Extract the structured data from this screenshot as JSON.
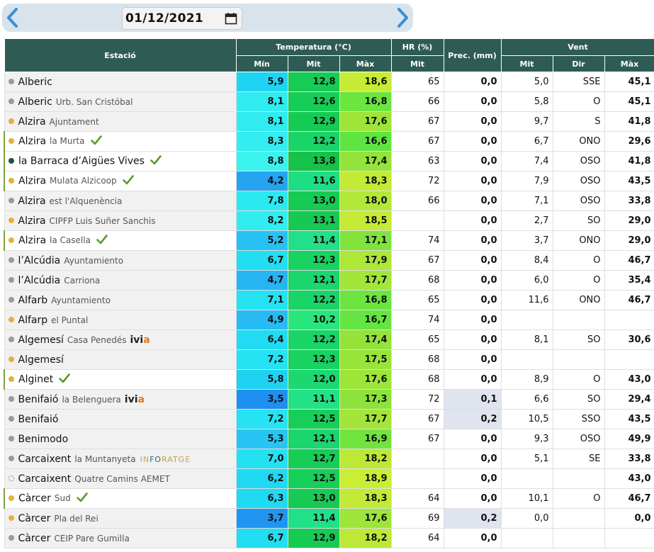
{
  "date_picker": {
    "value": "01/12/2021",
    "prev_icon": "chevron-left-icon",
    "next_icon": "chevron-right-icon",
    "calendar_icon": "calendar-icon",
    "accent": "#3a8fd6"
  },
  "table": {
    "headers": {
      "station": "Estació",
      "temperature": "Temperatura (°C)",
      "humidity": "HR (%)",
      "precipitation": "Prec. (mm)",
      "wind": "Vent"
    },
    "subheaders": {
      "temp_min": "Mín",
      "temp_mean": "Mit",
      "temp_max": "Màx",
      "hr_mean": "Mit",
      "wind_mean": "Mit",
      "wind_dir": "Dir",
      "wind_max": "Màx"
    },
    "header_color": "#2e5c54",
    "rows": [
      {
        "city": "Alberic",
        "sub": "",
        "dot": "#9a9a9a",
        "check": false,
        "sel": false,
        "brand": "",
        "tmin": "5,9",
        "tmit": "12,8",
        "tmax": "18,6",
        "hr": "65",
        "prec": "0,0",
        "vmit": "5,0",
        "vdir": "SSE",
        "vmax": "45,1"
      },
      {
        "city": "Alberic",
        "sub": "Urb. San Cristóbal",
        "dot": "#9a9a9a",
        "check": false,
        "sel": false,
        "brand": "",
        "tmin": "8,1",
        "tmit": "12,6",
        "tmax": "16,8",
        "hr": "66",
        "prec": "0,0",
        "vmit": "5,8",
        "vdir": "O",
        "vmax": "45,1"
      },
      {
        "city": "Alzira",
        "sub": "Ajuntament",
        "dot": "#e3b23c",
        "check": false,
        "sel": false,
        "brand": "",
        "tmin": "8,1",
        "tmit": "12,9",
        "tmax": "17,6",
        "hr": "67",
        "prec": "0,0",
        "vmit": "9,7",
        "vdir": "S",
        "vmax": "41,8"
      },
      {
        "city": "Alzira",
        "sub": "la Murta",
        "dot": "#e3b23c",
        "check": true,
        "sel": true,
        "brand": "",
        "tmin": "8,3",
        "tmit": "12,2",
        "tmax": "16,6",
        "hr": "67",
        "prec": "0,0",
        "vmit": "6,7",
        "vdir": "ONO",
        "vmax": "29,6"
      },
      {
        "city": "la Barraca d’Aigües Vives",
        "sub": "",
        "dot": "#1f4f4a",
        "check": true,
        "sel": true,
        "brand": "",
        "tmin": "8,8",
        "tmit": "13,8",
        "tmax": "17,4",
        "hr": "63",
        "prec": "0,0",
        "vmit": "7,4",
        "vdir": "OSO",
        "vmax": "41,8"
      },
      {
        "city": "Alzira",
        "sub": "Mulata Alzicoop",
        "dot": "#e3b23c",
        "check": true,
        "sel": true,
        "brand": "",
        "tmin": "4,2",
        "tmit": "11,6",
        "tmax": "18,3",
        "hr": "72",
        "prec": "0,0",
        "vmit": "7,9",
        "vdir": "OSO",
        "vmax": "43,5"
      },
      {
        "city": "Alzira",
        "sub": "est l'Alquenència",
        "dot": "#9a9a9a",
        "check": false,
        "sel": false,
        "brand": "",
        "tmin": "7,8",
        "tmit": "13,0",
        "tmax": "18,0",
        "hr": "66",
        "prec": "0,0",
        "vmit": "7,1",
        "vdir": "OSO",
        "vmax": "33,8"
      },
      {
        "city": "Alzira",
        "sub": "CIPFP Luis Suñer Sanchis",
        "dot": "#e3b23c",
        "check": false,
        "sel": false,
        "brand": "",
        "tmin": "8,2",
        "tmit": "13,1",
        "tmax": "18,5",
        "hr": "",
        "prec": "0,0",
        "vmit": "2,7",
        "vdir": "SO",
        "vmax": "29,0"
      },
      {
        "city": "Alzira",
        "sub": "la Casella",
        "dot": "#e3b23c",
        "check": true,
        "sel": true,
        "brand": "",
        "tmin": "5,2",
        "tmit": "11,4",
        "tmax": "17,1",
        "hr": "74",
        "prec": "0,0",
        "vmit": "3,7",
        "vdir": "ONO",
        "vmax": "29,0"
      },
      {
        "city": "l’Alcúdia",
        "sub": "Ayuntamiento",
        "dot": "#9a9a9a",
        "check": false,
        "sel": false,
        "brand": "",
        "tmin": "6,7",
        "tmit": "12,3",
        "tmax": "17,9",
        "hr": "67",
        "prec": "0,0",
        "vmit": "8,4",
        "vdir": "O",
        "vmax": "46,7"
      },
      {
        "city": "l’Alcúdia",
        "sub": "Carriona",
        "dot": "#9a9a9a",
        "check": false,
        "sel": false,
        "brand": "",
        "tmin": "4,7",
        "tmit": "12,1",
        "tmax": "17,7",
        "hr": "68",
        "prec": "0,0",
        "vmit": "6,0",
        "vdir": "O",
        "vmax": "35,4"
      },
      {
        "city": "Alfarb",
        "sub": "Ayuntamiento",
        "dot": "#9a9a9a",
        "check": false,
        "sel": false,
        "brand": "",
        "tmin": "7,1",
        "tmit": "12,2",
        "tmax": "16,8",
        "hr": "65",
        "prec": "0,0",
        "vmit": "11,6",
        "vdir": "ONO",
        "vmax": "46,7"
      },
      {
        "city": "Alfarp",
        "sub": "el Puntal",
        "dot": "#e3b23c",
        "check": false,
        "sel": false,
        "brand": "",
        "tmin": "4,9",
        "tmit": "10,2",
        "tmax": "16,7",
        "hr": "74",
        "prec": "0,0",
        "vmit": "",
        "vdir": "",
        "vmax": ""
      },
      {
        "city": "Algemesí",
        "sub": "Casa Penedés",
        "dot": "#9a9a9a",
        "check": false,
        "sel": false,
        "brand": "ivia",
        "tmin": "6,4",
        "tmit": "12,2",
        "tmax": "17,4",
        "hr": "65",
        "prec": "0,0",
        "vmit": "8,1",
        "vdir": "SO",
        "vmax": "30,6"
      },
      {
        "city": "Algemesí",
        "sub": "",
        "dot": "#e3b23c",
        "check": false,
        "sel": false,
        "brand": "",
        "tmin": "7,2",
        "tmit": "12,3",
        "tmax": "17,5",
        "hr": "68",
        "prec": "0,0",
        "vmit": "",
        "vdir": "",
        "vmax": ""
      },
      {
        "city": "Alginet",
        "sub": "",
        "dot": "#e3b23c",
        "check": true,
        "sel": true,
        "brand": "",
        "tmin": "5,8",
        "tmit": "12,0",
        "tmax": "17,6",
        "hr": "68",
        "prec": "0,0",
        "vmit": "8,9",
        "vdir": "O",
        "vmax": "43,0"
      },
      {
        "city": "Benifaió",
        "sub": "la Belenguera",
        "dot": "#9a9a9a",
        "check": false,
        "sel": false,
        "brand": "ivia",
        "tmin": "3,5",
        "tmit": "11,1",
        "tmax": "17,3",
        "hr": "72",
        "prec": "0,1",
        "vmit": "6,6",
        "vdir": "SO",
        "vmax": "29,4"
      },
      {
        "city": "Benifaió",
        "sub": "",
        "dot": "#9a9a9a",
        "check": false,
        "sel": false,
        "brand": "",
        "tmin": "7,2",
        "tmit": "12,5",
        "tmax": "17,7",
        "hr": "67",
        "prec": "0,2",
        "vmit": "10,5",
        "vdir": "SSO",
        "vmax": "43,5"
      },
      {
        "city": "Benimodo",
        "sub": "",
        "dot": "#9a9a9a",
        "check": false,
        "sel": false,
        "brand": "",
        "tmin": "5,3",
        "tmit": "12,1",
        "tmax": "16,9",
        "hr": "67",
        "prec": "0,0",
        "vmit": "9,3",
        "vdir": "OSO",
        "vmax": "49,9"
      },
      {
        "city": "Carcaixent",
        "sub": "la Muntanyeta",
        "dot": "#9a9a9a",
        "check": false,
        "sel": false,
        "brand": "inforatge",
        "tmin": "7,0",
        "tmit": "12,7",
        "tmax": "18,2",
        "hr": "",
        "prec": "0,0",
        "vmit": "5,1",
        "vdir": "SE",
        "vmax": "33,8"
      },
      {
        "city": "Carcaixent",
        "sub": "Quatre Camins AEMET",
        "dot": "hollow",
        "check": false,
        "sel": false,
        "brand": "",
        "tmin": "6,2",
        "tmit": "12,5",
        "tmax": "18,9",
        "hr": "",
        "prec": "0,0",
        "vmit": "",
        "vdir": "",
        "vmax": "43,0"
      },
      {
        "city": "Càrcer",
        "sub": "Sud",
        "dot": "#e3b23c",
        "check": true,
        "sel": true,
        "brand": "",
        "tmin": "6,3",
        "tmit": "13,0",
        "tmax": "18,3",
        "hr": "64",
        "prec": "0,0",
        "vmit": "10,1",
        "vdir": "O",
        "vmax": "46,7"
      },
      {
        "city": "Càrcer",
        "sub": "Pla del Rei",
        "dot": "#e3b23c",
        "check": false,
        "sel": false,
        "brand": "",
        "tmin": "3,7",
        "tmit": "11,4",
        "tmax": "17,6",
        "hr": "69",
        "prec": "0,2",
        "vmit": "0,0",
        "vdir": "",
        "vmax": "0,0"
      },
      {
        "city": "Càrcer",
        "sub": "CEIP Pare Gumilla",
        "dot": "#9a9a9a",
        "check": false,
        "sel": false,
        "brand": "",
        "tmin": "6,7",
        "tmit": "12,9",
        "tmax": "18,2",
        "hr": "64",
        "prec": "0,0",
        "vmit": "",
        "vdir": "",
        "vmax": ""
      }
    ]
  }
}
